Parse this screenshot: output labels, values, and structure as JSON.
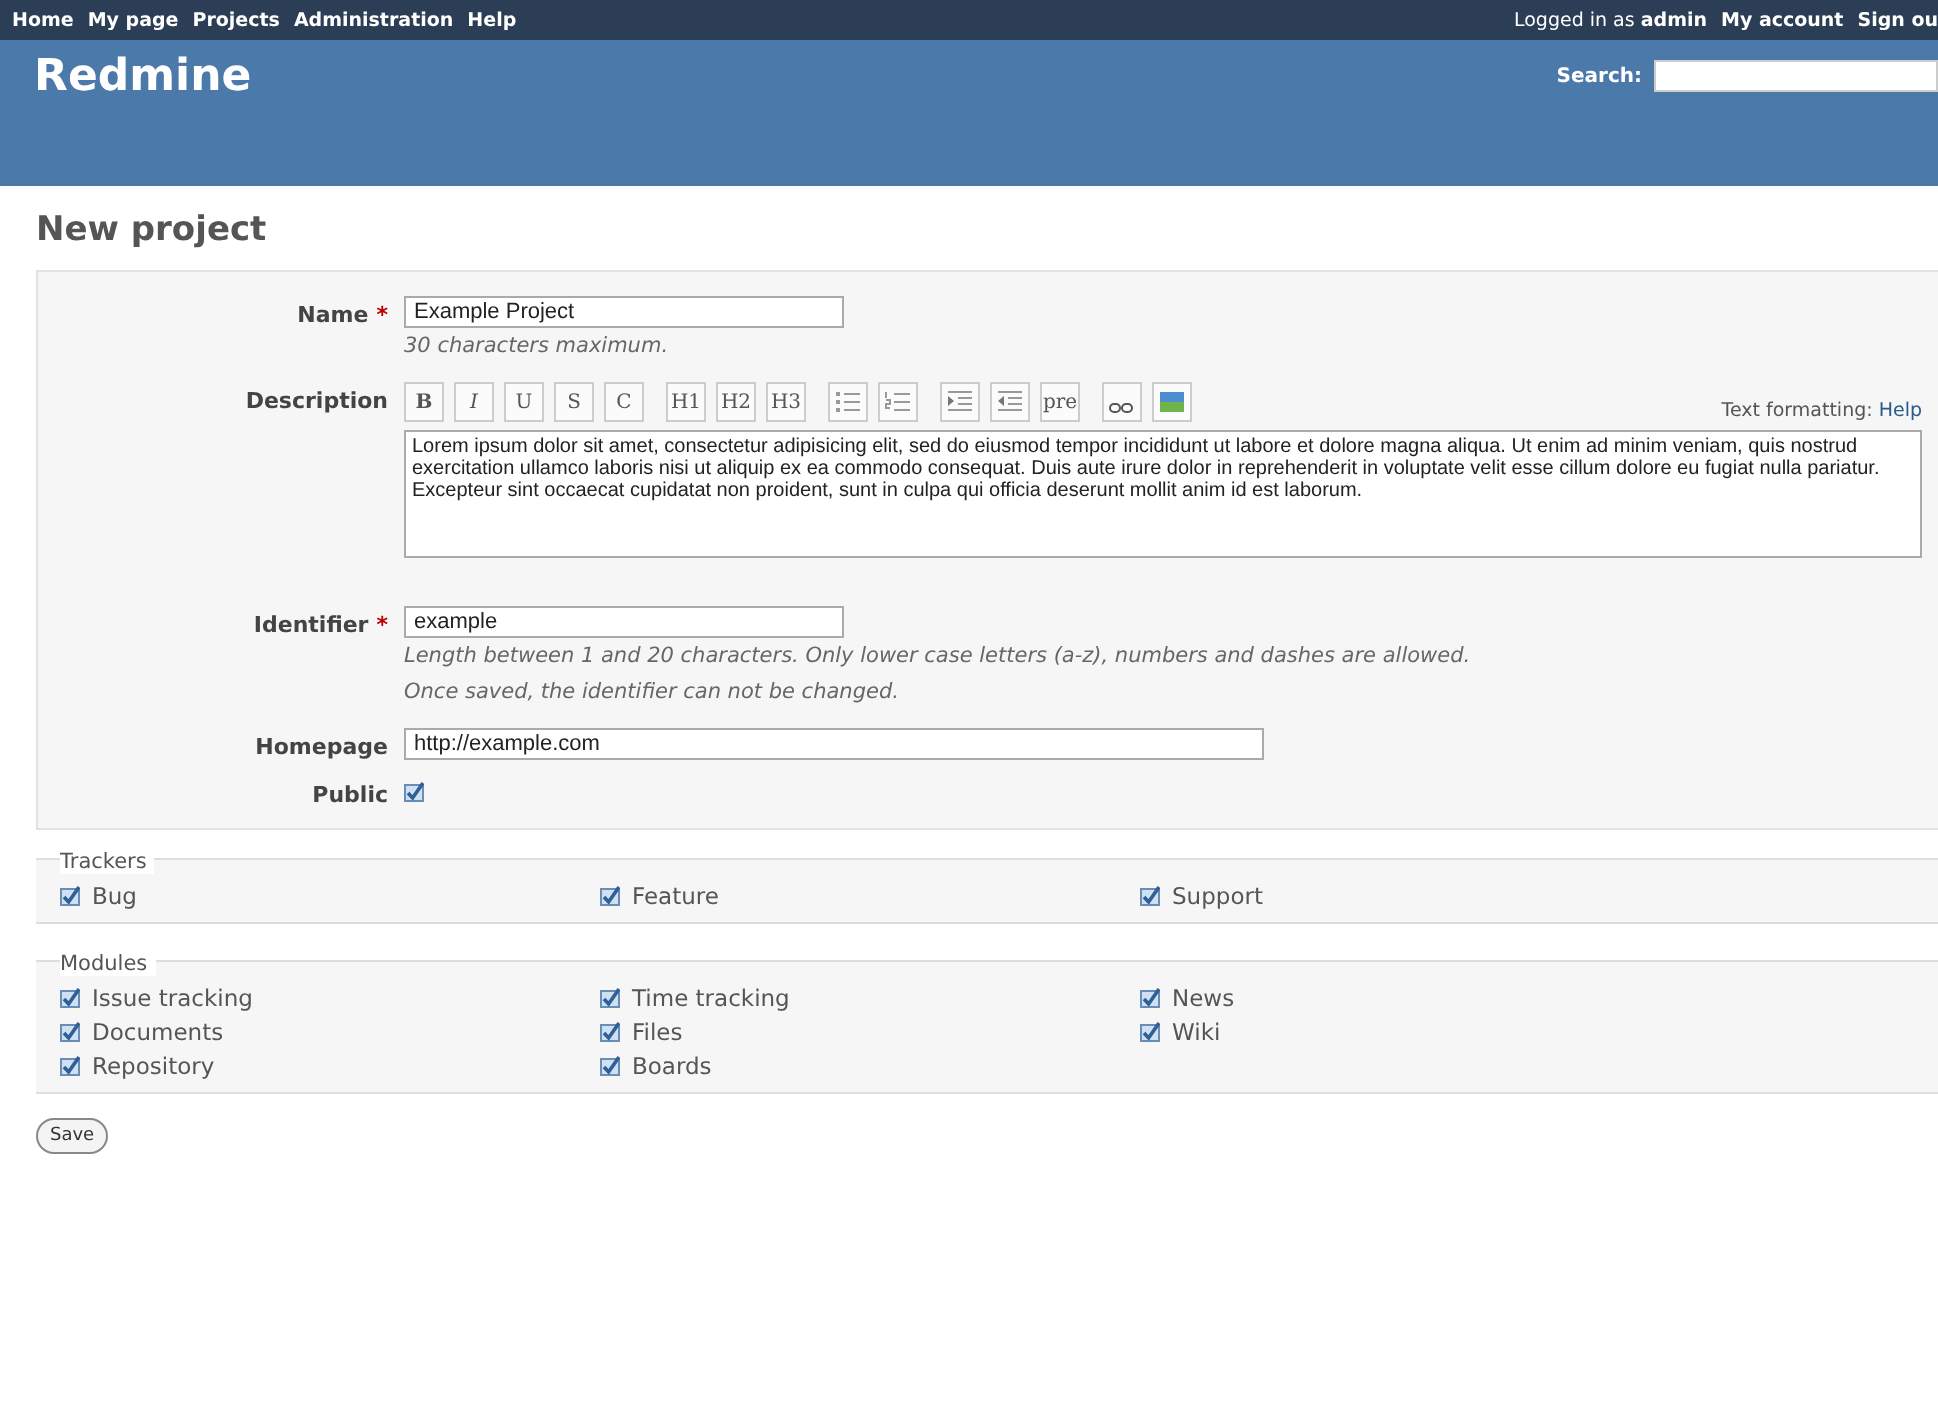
{
  "top_menu": {
    "left": [
      "Home",
      "My page",
      "Projects",
      "Administration",
      "Help"
    ],
    "logged_in": {
      "text": "Logged in as",
      "user": "admin"
    },
    "right": [
      "My account",
      "Sign ou"
    ]
  },
  "header": {
    "title": "Redmine",
    "search": {
      "label": "Search:"
    }
  },
  "page_title": "New project",
  "form": {
    "name": {
      "label": "Name",
      "required_mark": "*",
      "value": "Example Project",
      "hint": "30 characters maximum."
    },
    "description": {
      "label": "Description",
      "toolbar": [
        {
          "kind": "text",
          "text": "B"
        },
        {
          "kind": "text",
          "text": "I"
        },
        {
          "kind": "text",
          "text": "U"
        },
        {
          "kind": "text",
          "text": "S"
        },
        {
          "kind": "text",
          "text": "C"
        },
        {
          "kind": "text",
          "text": "H1"
        },
        {
          "kind": "text",
          "text": "H2"
        },
        {
          "kind": "text",
          "text": "H3"
        },
        {
          "kind": "ul"
        },
        {
          "kind": "ol"
        },
        {
          "kind": "indent"
        },
        {
          "kind": "outdent"
        },
        {
          "kind": "text",
          "text": "pre"
        },
        {
          "kind": "link"
        },
        {
          "kind": "image"
        }
      ],
      "formatting_label": "Text formatting:",
      "formatting_link": "Help",
      "value": "Lorem ipsum dolor sit amet, consectetur adipisicing elit, sed do eiusmod tempor incididunt ut labore et dolore magna aliqua. Ut enim ad minim veniam, quis nostrud exercitation ullamco laboris nisi ut aliquip ex ea commodo consequat. Duis aute irure dolor in reprehenderit in voluptate velit esse cillum dolore eu fugiat nulla pariatur. Excepteur sint occaecat cupidatat non proident, sunt in culpa qui officia deserunt mollit anim id est laborum."
    },
    "identifier": {
      "label": "Identifier",
      "required_mark": "*",
      "value": "example",
      "hints": [
        "Length between 1 and 20 characters. Only lower case letters (a-z), numbers and dashes are allowed.",
        "Once saved, the identifier can not be changed."
      ]
    },
    "homepage": {
      "label": "Homepage",
      "value": "http://example.com"
    },
    "public": {
      "label": "Public",
      "checked": true
    }
  },
  "trackers": {
    "legend": "Trackers",
    "items": [
      {
        "label": "Bug",
        "checked": true
      },
      {
        "label": "Feature",
        "checked": true
      },
      {
        "label": "Support",
        "checked": true
      }
    ]
  },
  "modules": {
    "legend": "Modules",
    "items": [
      {
        "label": "Issue tracking",
        "checked": true
      },
      {
        "label": "Time tracking",
        "checked": true
      },
      {
        "label": "News",
        "checked": true
      },
      {
        "label": "Documents",
        "checked": true
      },
      {
        "label": "Files",
        "checked": true
      },
      {
        "label": "Wiki",
        "checked": true
      },
      {
        "label": "Repository",
        "checked": true
      },
      {
        "label": "Boards",
        "checked": true
      }
    ]
  },
  "save_button": "Save"
}
